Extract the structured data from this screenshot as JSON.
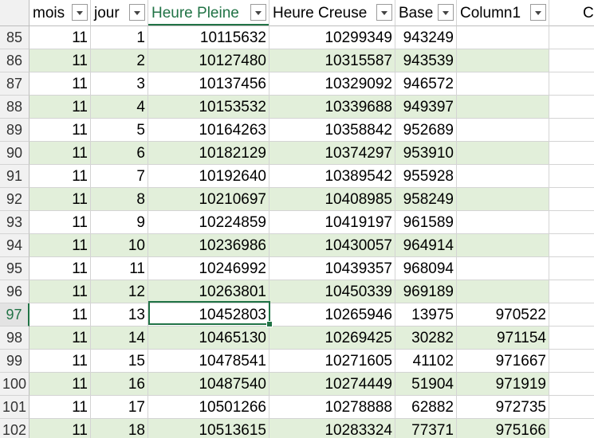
{
  "headers": [
    "mois",
    "jour",
    "Heure Pleine",
    "Heure Creuse",
    "Base",
    "Column1"
  ],
  "next_column_letter": "C",
  "active_row": "97",
  "active_cell_value": "10452803",
  "rows": [
    {
      "n": "85",
      "mois": "11",
      "jour": "1",
      "hp": "10115632",
      "hc": "10299349",
      "base": "943249",
      "col1": ""
    },
    {
      "n": "86",
      "mois": "11",
      "jour": "2",
      "hp": "10127480",
      "hc": "10315587",
      "base": "943539",
      "col1": ""
    },
    {
      "n": "87",
      "mois": "11",
      "jour": "3",
      "hp": "10137456",
      "hc": "10329092",
      "base": "946572",
      "col1": ""
    },
    {
      "n": "88",
      "mois": "11",
      "jour": "4",
      "hp": "10153532",
      "hc": "10339688",
      "base": "949397",
      "col1": ""
    },
    {
      "n": "89",
      "mois": "11",
      "jour": "5",
      "hp": "10164263",
      "hc": "10358842",
      "base": "952689",
      "col1": ""
    },
    {
      "n": "90",
      "mois": "11",
      "jour": "6",
      "hp": "10182129",
      "hc": "10374297",
      "base": "953910",
      "col1": ""
    },
    {
      "n": "91",
      "mois": "11",
      "jour": "7",
      "hp": "10192640",
      "hc": "10389542",
      "base": "955928",
      "col1": ""
    },
    {
      "n": "92",
      "mois": "11",
      "jour": "8",
      "hp": "10210697",
      "hc": "10408985",
      "base": "958249",
      "col1": ""
    },
    {
      "n": "93",
      "mois": "11",
      "jour": "9",
      "hp": "10224859",
      "hc": "10419197",
      "base": "961589",
      "col1": ""
    },
    {
      "n": "94",
      "mois": "11",
      "jour": "10",
      "hp": "10236986",
      "hc": "10430057",
      "base": "964914",
      "col1": ""
    },
    {
      "n": "95",
      "mois": "11",
      "jour": "11",
      "hp": "10246992",
      "hc": "10439357",
      "base": "968094",
      "col1": ""
    },
    {
      "n": "96",
      "mois": "11",
      "jour": "12",
      "hp": "10263801",
      "hc": "10450339",
      "base": "969189",
      "col1": ""
    },
    {
      "n": "97",
      "mois": "11",
      "jour": "13",
      "hp": "10452803",
      "hc": "10265946",
      "base": "13975",
      "col1": "970522"
    },
    {
      "n": "98",
      "mois": "11",
      "jour": "14",
      "hp": "10465130",
      "hc": "10269425",
      "base": "30282",
      "col1": "971154"
    },
    {
      "n": "99",
      "mois": "11",
      "jour": "15",
      "hp": "10478541",
      "hc": "10271605",
      "base": "41102",
      "col1": "971667"
    },
    {
      "n": "100",
      "mois": "11",
      "jour": "16",
      "hp": "10487540",
      "hc": "10274449",
      "base": "51904",
      "col1": "971919"
    },
    {
      "n": "101",
      "mois": "11",
      "jour": "17",
      "hp": "10501266",
      "hc": "10278888",
      "base": "62882",
      "col1": "972735"
    },
    {
      "n": "102",
      "mois": "11",
      "jour": "18",
      "hp": "10513615",
      "hc": "10283324",
      "base": "77371",
      "col1": "975166"
    }
  ],
  "colors": {
    "band": "#e2efda",
    "accent": "#217346",
    "gridline": "#d4d4d4"
  },
  "icons": {
    "filter_button": "chevron-down-icon"
  }
}
